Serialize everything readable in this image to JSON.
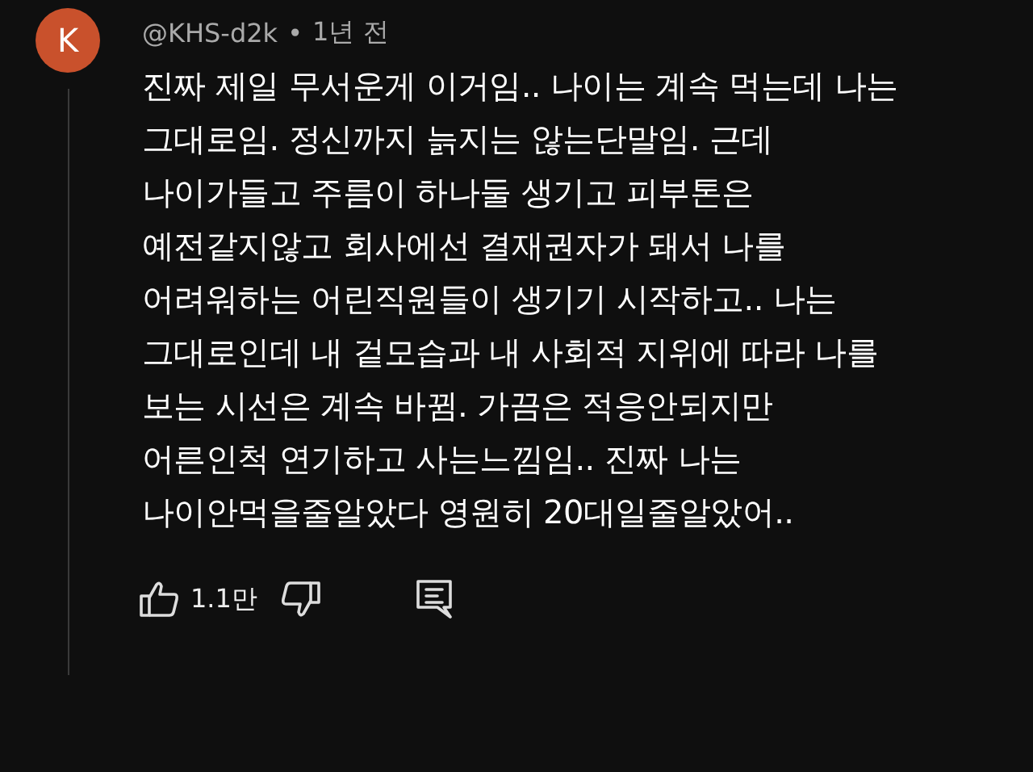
{
  "comment": {
    "avatar_letter": "K",
    "author": "@KHS-d2k",
    "separator": "•",
    "time": "1년 전",
    "lines": [
      "진짜 제일 무서운게 이거임.. 나이는 계속 먹는데 나는",
      "그대로임. 정신까지 늙지는 않는단말임. 근데",
      "나이가들고 주름이 하나둘 생기고 피부톤은",
      "예전같지않고 회사에선 결재권자가 돼서 나를",
      "어려워하는 어린직원들이 생기기 시작하고.. 나는",
      "그대로인데 내 겉모습과 내 사회적 지위에 따라 나를",
      "보는 시선은 계속 바뀜. 가끔은 적응안되지만",
      "어른인척 연기하고 사는느낌임.. 진짜 나는",
      "나이안먹을줄알았다 영원히 20대일줄알았어.."
    ],
    "likes": "1.1만"
  }
}
